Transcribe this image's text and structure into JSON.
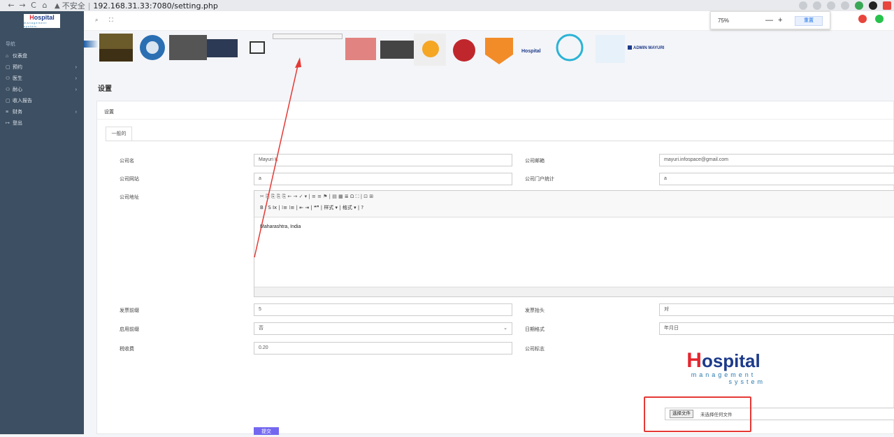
{
  "browser": {
    "back": "←",
    "forward": "→",
    "reload": "C",
    "home": "⌂",
    "security_warning": "▲",
    "security_text": "不安全",
    "url": "192.168.31.33:7080/setting.php"
  },
  "sidebar": {
    "logo_text": "ospital",
    "logo_sub": "management system",
    "section": "导航",
    "items": [
      {
        "label": "仪表盘",
        "icon": "⌂",
        "has_children": false
      },
      {
        "label": "预约",
        "icon": "▢",
        "has_children": true
      },
      {
        "label": "医生",
        "icon": "⚇",
        "has_children": true
      },
      {
        "label": "耐心",
        "icon": "⚇",
        "has_children": true
      },
      {
        "label": "收入报告",
        "icon": "▢",
        "has_children": false
      },
      {
        "label": "财务",
        "icon": "≡",
        "has_children": true
      },
      {
        "label": "登出",
        "icon": "↦",
        "has_children": false
      }
    ]
  },
  "topbar": {
    "search_icon": "⌕",
    "fullscreen_icon": "⛶",
    "zoom_level": "75%",
    "zoom_minus": "—",
    "zoom_plus": "+",
    "zoom_reset": "重置",
    "badge_colors": [
      "#e8453c",
      "#27c24c"
    ]
  },
  "page": {
    "title": "设置",
    "card_title": "设置",
    "tab_general": "一般的"
  },
  "form": {
    "company_name_label": "公司名",
    "company_name_value": "Mayuri K",
    "company_email_label": "公司邮箱",
    "company_email_value": "mayuri.infospace@gmail.com",
    "company_website_label": "公司网站",
    "company_website_value": "a",
    "company_gst_label": "公司门户统计",
    "company_gst_value": "a",
    "company_address_label": "公司地址",
    "editor_toolbar_row1": "✂ ⎘ ⎘ ⎘ ⎘ ← → ✓ ▾ | ≡ ≡ ⚑ | ▤ ▦ ≣ Ω ⛶ | ⊡ ⊞",
    "editor_toolbar_row2": "B I S Ix | ⁞≡ ⁞≡ | ⇤ ⇥ | ❝❞ | 样式 ▾ | 格式 ▾ | ?",
    "company_address_value": "Maharashtra, India",
    "invoice_prefix_label": "发票前缀",
    "invoice_prefix_value": "5",
    "invoice_header_label": "发票抬头",
    "invoice_header_value": "对",
    "currency_label": "启用前缀",
    "currency_value": "否",
    "date_format_label": "日期格式",
    "date_format_value": "年月日",
    "tax_label": "税收费",
    "tax_value": "0.20",
    "logo_label": "公司标志",
    "logo_title": "ospital",
    "logo_sub1": "management",
    "logo_sub2": "system",
    "file_button": "选择文件",
    "file_status": "未选择任何文件",
    "submit": "提交"
  },
  "image_strip": {
    "admin_label": "ADMIN MAYURI"
  }
}
